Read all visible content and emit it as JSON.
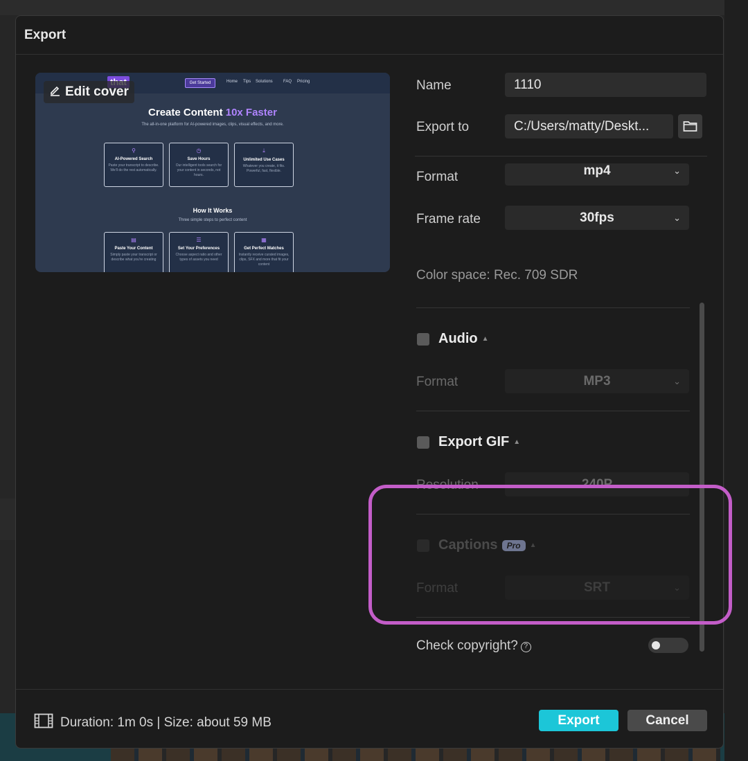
{
  "dialog": {
    "title": "Export"
  },
  "preview": {
    "edit_cover_label": "Edit cover",
    "thumb": {
      "logo": "that",
      "nav_button": "Get Started",
      "nav_links": [
        "Home",
        "Tips",
        "Solutions",
        "FAQ",
        "Pricing"
      ],
      "headline": "Create Content ",
      "headline_accent": "10x Faster",
      "subline": "The all-in-one platform for AI-powered images, clips, visual effects, and more.",
      "features": [
        {
          "title": "AI-Powered Search",
          "desc": "Paste your transcript to describe. We'll do the rest automatically."
        },
        {
          "title": "Save Hours",
          "desc": "Our intelligent tools search for your content in seconds, not hours."
        },
        {
          "title": "Unlimited Use Cases",
          "desc": "Whatever you create, it fits. Powerful, fast, flexible."
        }
      ],
      "section2_title": "How It Works",
      "section2_sub": "Three simple steps to perfect content",
      "steps": [
        {
          "title": "Paste Your Content",
          "desc": "Simply paste your transcript or describe what you're creating"
        },
        {
          "title": "Set Your Preferences",
          "desc": "Choose aspect ratio and other types of assets you need"
        },
        {
          "title": "Get Perfect Matches",
          "desc": "Instantly receive curated images, clips, SFX and more that fit your content"
        }
      ]
    }
  },
  "settings": {
    "name_label": "Name",
    "name_value": "1110",
    "export_to_label": "Export to",
    "export_to_value": "C:/Users/matty/Deskt...",
    "format_label": "Format",
    "format_value": "mp4",
    "frame_rate_label": "Frame rate",
    "frame_rate_value": "30fps",
    "color_space": "Color space: Rec. 709 SDR"
  },
  "audio": {
    "title": "Audio",
    "format_label": "Format",
    "format_value": "MP3"
  },
  "gif": {
    "title": "Export GIF",
    "resolution_label": "Resolution",
    "resolution_value": "240P"
  },
  "captions": {
    "title": "Captions",
    "badge": "Pro",
    "format_label": "Format",
    "format_value": "SRT"
  },
  "copyright": {
    "label": "Check copyright?",
    "toggle_on": false
  },
  "footer": {
    "duration_text": "Duration: 1m 0s | Size: about 59 MB",
    "export_label": "Export",
    "cancel_label": "Cancel"
  },
  "colors": {
    "accent": "#1cc6d8",
    "highlight": "#c35dc8",
    "pro_badge": "#9aa4bf"
  }
}
